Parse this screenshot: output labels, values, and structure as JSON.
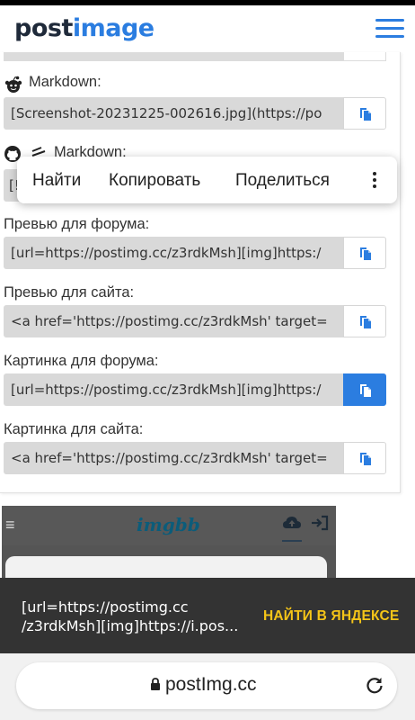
{
  "header": {
    "logo_part1": "post",
    "logo_part2": "image",
    "accent_color": "#2b7de0",
    "menu_icon": "hamburger-icon"
  },
  "links": [
    {
      "label": "Markdown:",
      "icon": "reddit-icon",
      "value": "[Screenshot-20231225-002616.jpg](https://po"
    },
    {
      "label": "Markdown:",
      "icon": "github-icon",
      "value": "[!"
    },
    {
      "label": "Превью для форума:",
      "value": "[url=https://postimg.cc/z3rdkMsh][img]https:/"
    },
    {
      "label": "Превью для сайта:",
      "value": "<a href='https://postimg.cc/z3rdkMsh' target="
    },
    {
      "label": "Картинка для форума:",
      "value": "[url=https://postimg.cc/z3rdkMsh][img]https:/"
    },
    {
      "label": "Картинка для сайта:",
      "value": "<a href='https://postimg.cc/z3rdkMsh' target="
    }
  ],
  "copy_icon": "copy-icon",
  "selection_popup": {
    "find": "Найти",
    "copy": "Копировать",
    "share": "Поделиться",
    "more_icon": "more-vertical-icon"
  },
  "preview": {
    "logo": "imgbb",
    "menu_glyph": "≡"
  },
  "snackbar": {
    "line1": "[url=https://postimg.cc",
    "line2": "/z3rdkMsh][img]https://i.pos...",
    "action": "НАЙТИ В ЯНДЕКСЕ",
    "action_color": "#f5c518"
  },
  "browser": {
    "url": "postImg.cc",
    "lock_icon": "lock-icon",
    "reload_icon": "reload-icon"
  }
}
